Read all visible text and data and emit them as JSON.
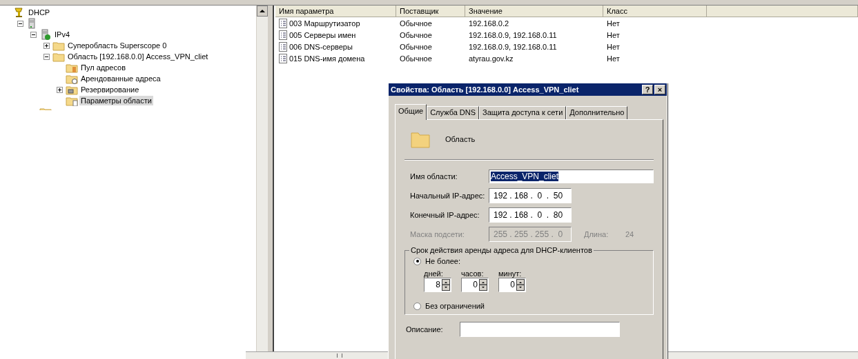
{
  "tree": [
    {
      "label": "DHCP",
      "kind": "dhcp",
      "selected": false,
      "children": [
        {
          "kind": "server",
          "expanded": true,
          "selected": false,
          "children": [
            {
              "label": "IPv4",
              "kind": "ipv4",
              "expanded": true,
              "selected": false,
              "children": [
                {
                  "label": "Суперобласть Superscope 0",
                  "kind": "folder",
                  "expanded": false,
                  "selected": false
                },
                {
                  "label": "Область [192.168.0.0] Access_VPN_cliet",
                  "kind": "folder",
                  "expanded": true,
                  "selected": false,
                  "children": [
                    {
                      "label": "Пул адресов",
                      "kind": "pool",
                      "selected": false
                    },
                    {
                      "label": "Арендованные адреса",
                      "kind": "leases",
                      "selected": false
                    },
                    {
                      "label": "Резервирование",
                      "kind": "reservation",
                      "expanded": false,
                      "selected": false
                    },
                    {
                      "label": "Параметры области",
                      "kind": "options",
                      "selected": true
                    }
                  ]
                }
              ]
            }
          ]
        }
      ]
    }
  ],
  "table": {
    "columns": [
      "Имя параметра",
      "Поставщик",
      "Значение",
      "Класс"
    ],
    "rows": [
      [
        "003 Маршрутизатор",
        "Обычное",
        "192.168.0.2",
        "Нет"
      ],
      [
        "005 Серверы имен",
        "Обычное",
        "192.168.0.9, 192.168.0.11",
        "Нет"
      ],
      [
        "006 DNS-серверы",
        "Обычное",
        "192.168.0.9, 192.168.0.11",
        "Нет"
      ],
      [
        "015 DNS-имя домена",
        "Обычное",
        "atyrau.gov.kz",
        "Нет"
      ]
    ]
  },
  "dialog": {
    "title": "Свойства: Область [192.168.0.0] Access_VPN_cliet",
    "help": "?",
    "close": "×",
    "tabs": [
      {
        "label": "Общие",
        "selected": true
      },
      {
        "label": "Служба DNS",
        "selected": false
      },
      {
        "label": "Защита доступа к сети",
        "selected": false
      },
      {
        "label": "Дополнительно",
        "selected": false
      }
    ],
    "heading": "Область",
    "fields": [
      {
        "label": "Имя области:",
        "value": "Access_VPN_cliet",
        "kind": "text",
        "disabled": false
      },
      {
        "label": "Начальный IP-адрес:",
        "value": "192 . 168 .  0  .  50",
        "kind": "ip",
        "disabled": false
      },
      {
        "label": "Конечный IP-адрес:",
        "value": "192 . 168 .  0  .  80",
        "kind": "ip",
        "disabled": false
      },
      {
        "label": "Маска подсети:",
        "value": "255 . 255 . 255 .  0",
        "kind": "ip",
        "disabled": true,
        "extra_label": "Длина:",
        "extra_value": "24"
      }
    ],
    "lease": {
      "title": "Срок действия аренды адреса для DHCP-клиентов",
      "options": [
        {
          "label": "Не более:",
          "selected": true
        },
        {
          "label": "Без ограничений",
          "selected": false
        }
      ],
      "spins": [
        {
          "label": "дней:",
          "value": "8"
        },
        {
          "label": "часов:",
          "value": "0"
        },
        {
          "label": "минут:",
          "value": "0"
        }
      ]
    },
    "description_label": "Описание:"
  }
}
